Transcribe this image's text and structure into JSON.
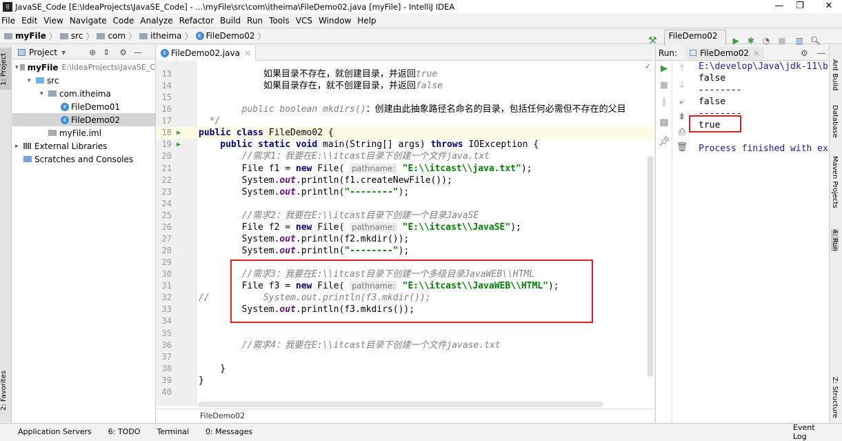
{
  "window": {
    "title": "JavaSE_Code [E:\\IdeaProjects\\JavaSE_Code] - ...\\myFile\\src\\com\\itheima\\FileDemo02.java [myFile] - IntelliJ IDEA",
    "minimize": "—",
    "restore": "❐",
    "close": "✕"
  },
  "menu": [
    "File",
    "Edit",
    "View",
    "Navigate",
    "Code",
    "Analyze",
    "Refactor",
    "Build",
    "Run",
    "Tools",
    "VCS",
    "Window",
    "Help"
  ],
  "breadcrumb": [
    "myFile",
    "src",
    "com",
    "itheima",
    "FileDemo02"
  ],
  "toolbar": {
    "run_config": "FileDemo02",
    "icons": [
      "build-hammer-icon",
      "run-icon",
      "debug-icon",
      "coverage-icon",
      "stop-icon",
      "project-structure-icon",
      "search-icon"
    ]
  },
  "left_stripe": {
    "project_tab": "1: Project",
    "favorites_tab": "2: Favorites"
  },
  "right_stripe": [
    "Ant Build",
    "Database",
    "Maven Projects",
    "4: Run",
    "Z: Structure"
  ],
  "project": {
    "header": "Project",
    "tree": [
      {
        "label": "myFile",
        "extra": "E:\\IdeaProjects\\JavaSE_C",
        "indent": 0,
        "arrow": "▾",
        "icon": "module",
        "bold": true
      },
      {
        "label": "src",
        "indent": 1,
        "arrow": "▾",
        "icon": "folder"
      },
      {
        "label": "com.itheima",
        "indent": 2,
        "arrow": "▾",
        "icon": "package"
      },
      {
        "label": "FileDemo01",
        "indent": 3,
        "arrow": "",
        "icon": "class"
      },
      {
        "label": "FileDemo02",
        "indent": 3,
        "arrow": "",
        "icon": "class",
        "selected": true
      },
      {
        "label": "myFile.iml",
        "indent": 2,
        "arrow": "",
        "icon": "file"
      },
      {
        "label": "External Libraries",
        "indent": 0,
        "arrow": "▸",
        "icon": "library"
      },
      {
        "label": "Scratches and Consoles",
        "indent": 0,
        "arrow": "",
        "icon": "scratch"
      }
    ]
  },
  "editor": {
    "tab": "FileDemo02.java",
    "footer": "FileDemo02",
    "lines": [
      {
        "n": 13,
        "t": [
          [
            "",
            "            如果目录不存在，就创建目录，并返回"
          ],
          [
            "cm",
            "true"
          ]
        ]
      },
      {
        "n": 14,
        "t": [
          [
            "",
            "            如果目录存在，就不创建目录，并返回"
          ],
          [
            "cm",
            "false"
          ]
        ]
      },
      {
        "n": 15,
        "t": []
      },
      {
        "n": 16,
        "t": [
          [
            "cm",
            "        public boolean mkdirs()"
          ],
          [
            "",
            "：创建由此抽象路径名命名的目录，包括任何必需但不存在的父目"
          ]
        ]
      },
      {
        "n": 17,
        "t": [
          [
            "cm",
            "  */"
          ]
        ]
      },
      {
        "n": 18,
        "run": true,
        "t": [
          [
            "kw",
            "public class "
          ],
          [
            "",
            "FileDemo02 {"
          ]
        ]
      },
      {
        "n": 19,
        "run": true,
        "t": [
          [
            "kw",
            "    public static void "
          ],
          [
            "",
            "main(String[] args) "
          ],
          [
            "kw",
            "throws "
          ],
          [
            "",
            "IOException {"
          ]
        ]
      },
      {
        "n": 20,
        "t": [
          [
            "cm",
            "        //需求1：我要在E:\\\\itcast目录下创建一个文件java.txt"
          ]
        ]
      },
      {
        "n": 21,
        "t": [
          [
            "",
            "        File f1 = "
          ],
          [
            "kw",
            "new "
          ],
          [
            "",
            "File( "
          ],
          [
            "hint",
            "pathname:"
          ],
          [
            "str",
            " \"E:\\\\itcast\\\\java.txt\""
          ],
          [
            "",
            ");"
          ]
        ]
      },
      {
        "n": 22,
        "t": [
          [
            "",
            "        System."
          ],
          [
            "st",
            "out"
          ],
          [
            "",
            ".println(f1.createNewFile());"
          ]
        ]
      },
      {
        "n": 23,
        "t": [
          [
            "",
            "        System."
          ],
          [
            "st",
            "out"
          ],
          [
            "",
            ".println("
          ],
          [
            "str",
            "\"--------\""
          ],
          [
            "",
            ");"
          ]
        ]
      },
      {
        "n": 24,
        "t": []
      },
      {
        "n": 25,
        "t": [
          [
            "cm",
            "        //需求2：我要在E:\\\\itcast目录下创建一个目录JavaSE"
          ]
        ]
      },
      {
        "n": 26,
        "t": [
          [
            "",
            "        File f2 = "
          ],
          [
            "kw",
            "new "
          ],
          [
            "",
            "File( "
          ],
          [
            "hint",
            "pathname:"
          ],
          [
            "str",
            " \"E:\\\\itcast\\\\JavaSE\""
          ],
          [
            "",
            ");"
          ]
        ]
      },
      {
        "n": 27,
        "t": [
          [
            "",
            "        System."
          ],
          [
            "st",
            "out"
          ],
          [
            "",
            ".println(f2.mkdir());"
          ]
        ]
      },
      {
        "n": 28,
        "t": [
          [
            "",
            "        System."
          ],
          [
            "st",
            "out"
          ],
          [
            "",
            ".println("
          ],
          [
            "str",
            "\"--------\""
          ],
          [
            "",
            ");"
          ]
        ]
      },
      {
        "n": 29,
        "t": []
      },
      {
        "n": 30,
        "t": [
          [
            "cm",
            "        //需求3：我要在E:\\\\itcast目录下创建一个多级目录JavaWEB\\\\HTML"
          ]
        ]
      },
      {
        "n": 31,
        "t": [
          [
            "",
            "        File f3 = "
          ],
          [
            "kw",
            "new "
          ],
          [
            "",
            "File( "
          ],
          [
            "hint",
            "pathname:"
          ],
          [
            "str",
            " \"E:\\\\itcast\\\\JavaWEB\\\\HTML\""
          ],
          [
            "",
            ");"
          ]
        ]
      },
      {
        "n": 32,
        "t": [
          [
            "cm",
            "//          System.out.println(f3.mkdir());"
          ]
        ]
      },
      {
        "n": 33,
        "t": [
          [
            "",
            "        System."
          ],
          [
            "st",
            "out"
          ],
          [
            "",
            ".println(f3.mkdirs());"
          ]
        ]
      },
      {
        "n": 34,
        "t": []
      },
      {
        "n": 35,
        "t": []
      },
      {
        "n": 36,
        "t": [
          [
            "cm",
            "        //需求4：我要在E:\\\\itcast目录下创建一个文件javase.txt"
          ]
        ]
      },
      {
        "n": 37,
        "t": []
      },
      {
        "n": 38,
        "t": [
          [
            "",
            "    }"
          ]
        ]
      },
      {
        "n": 39,
        "t": [
          [
            "",
            "}"
          ]
        ]
      },
      {
        "n": 40,
        "t": []
      }
    ]
  },
  "run": {
    "label": "Run:",
    "tab": "FileDemo02",
    "console": [
      "E:\\develop\\Java\\jdk-11\\b",
      "false",
      "--------",
      "false",
      "--------",
      "true",
      "",
      "Process finished with ex"
    ]
  },
  "statusbar": {
    "items": [
      "Application Servers",
      "6: TODO",
      "Terminal",
      "0: Messages"
    ],
    "event_log": "Event Log"
  },
  "colors": {
    "highlight_box": "#e02020",
    "keyword": "#000080",
    "string": "#008000",
    "comment": "#808080"
  }
}
